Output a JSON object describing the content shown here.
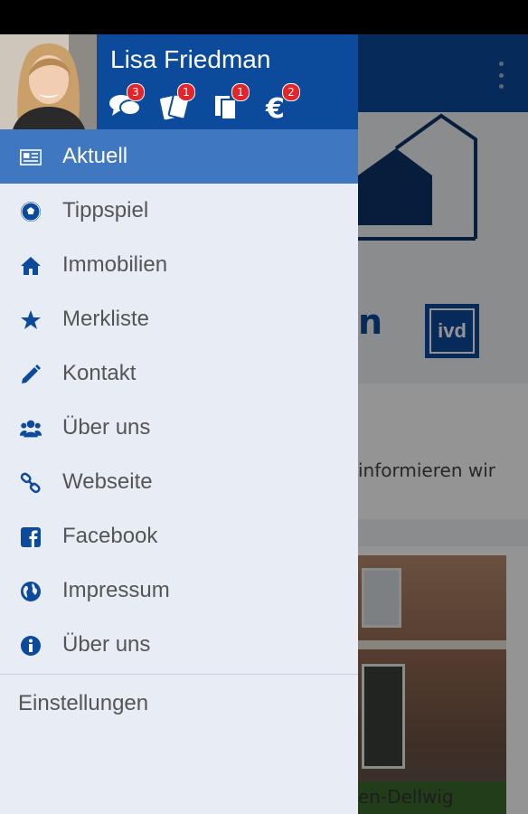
{
  "user": {
    "name": "Lisa Friedman"
  },
  "badges": [
    {
      "icon": "chat-icon",
      "count": "3"
    },
    {
      "icon": "cards-icon",
      "count": "1"
    },
    {
      "icon": "documents-icon",
      "count": "1"
    },
    {
      "icon": "euro-icon",
      "count": "2"
    }
  ],
  "menu": {
    "items": [
      {
        "label": "Aktuell",
        "icon": "newspaper-icon",
        "active": true
      },
      {
        "label": "Tippspiel",
        "icon": "soccer-ball-icon"
      },
      {
        "label": "Immobilien",
        "icon": "home-icon"
      },
      {
        "label": "Merkliste",
        "icon": "star-icon"
      },
      {
        "label": "Kontakt",
        "icon": "pencil-icon"
      },
      {
        "label": "Über uns",
        "icon": "group-icon"
      },
      {
        "label": "Webseite",
        "icon": "link-icon"
      },
      {
        "label": "Facebook",
        "icon": "facebook-icon"
      },
      {
        "label": "Impressum",
        "icon": "globe-icon"
      },
      {
        "label": "Über uns",
        "icon": "info-icon"
      }
    ],
    "settings_label": "Einstellungen"
  },
  "background": {
    "brand_fragment": "n",
    "ivd_logo": "ivd",
    "info_text": "informieren wir",
    "info_text_tail": "",
    "photo_caption": "en-Dellwig"
  },
  "colors": {
    "primary": "#0c4a9c",
    "active_item": "#3f77c1",
    "badge": "#e3242b",
    "drawer_bg": "#e8edf5"
  }
}
